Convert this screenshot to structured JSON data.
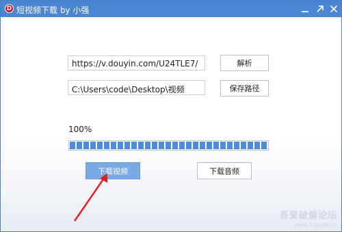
{
  "window": {
    "app_icon_letter": "D",
    "title": "短视频下载 by 小强"
  },
  "titlebar_buttons": {
    "minimize": "minimize-icon",
    "maximize": "maximize-icon",
    "close": "close-icon"
  },
  "inputs": {
    "url_value": "https://v.douyin.com/U24TLE7/",
    "path_value": "C:\\Users\\code\\Desktop\\视频"
  },
  "buttons": {
    "parse_label": "解析",
    "save_path_label": "保存路径",
    "download_video_label": "下载视频",
    "download_audio_label": "下载音频"
  },
  "progress": {
    "label": "100%",
    "value": 1.0
  },
  "annotation": {
    "arrow_color": "#e02020"
  },
  "watermark": {
    "title": "吾爱破解论坛",
    "url": "www.52pojie.cn"
  },
  "colors": {
    "titlebar": "#4a86d1",
    "accent": "#7aa9e8",
    "progress": "#4e8bd8"
  }
}
